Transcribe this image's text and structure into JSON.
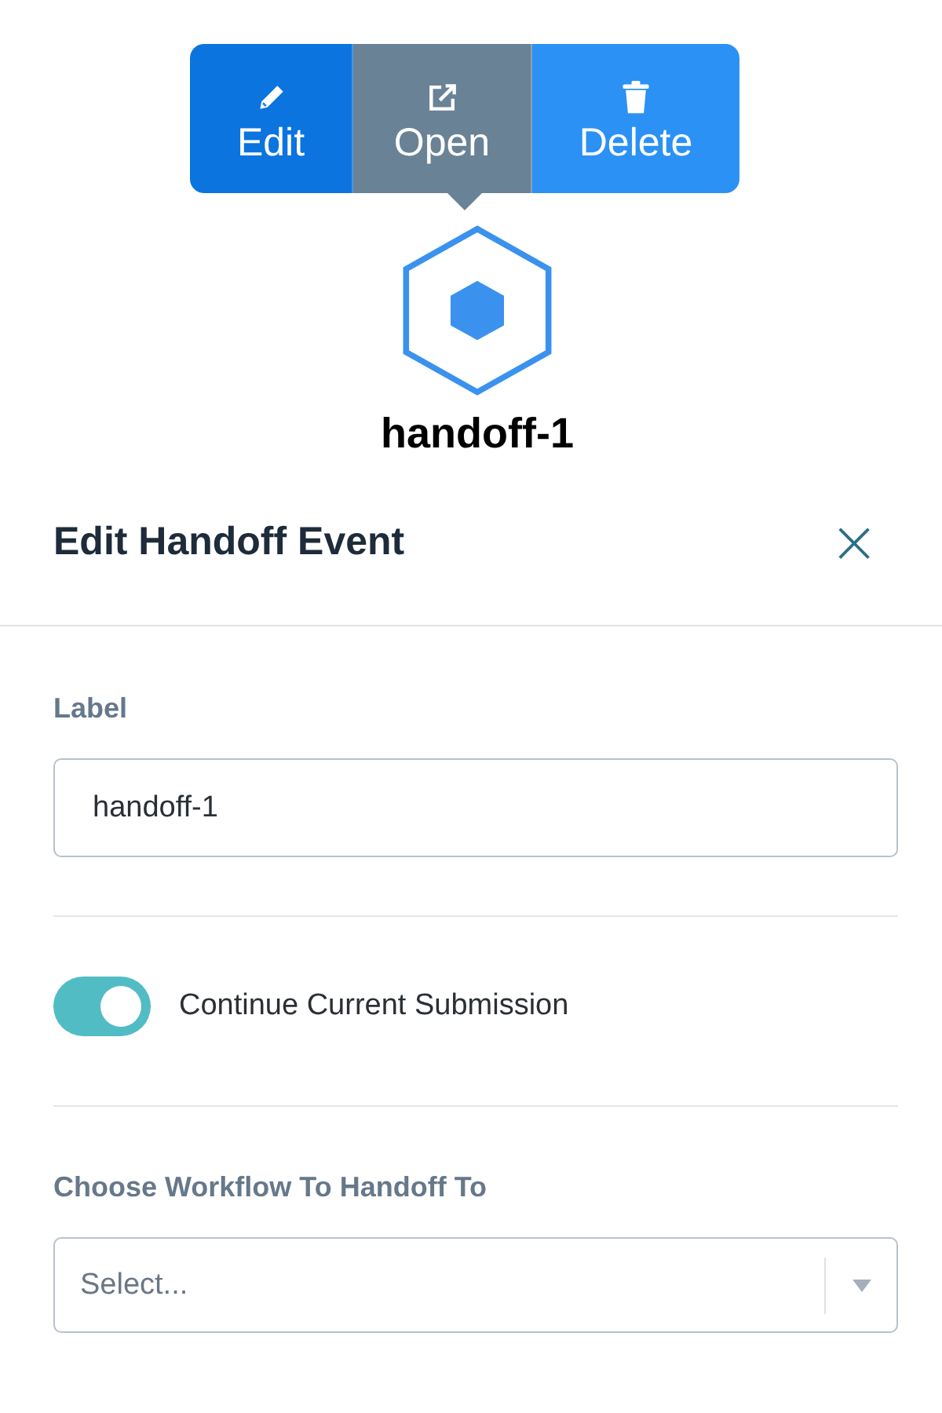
{
  "node_toolbar": {
    "buttons": [
      {
        "kind": "edit",
        "label": "Edit",
        "color": "#0b74de"
      },
      {
        "kind": "open",
        "label": "Open",
        "color": "#6a8296"
      },
      {
        "kind": "delete",
        "label": "Delete",
        "color": "#2b91f5"
      }
    ]
  },
  "node": {
    "label": "handoff-1"
  },
  "panel": {
    "title": "Edit Handoff Event",
    "close": "×",
    "label_field": {
      "label": "Label",
      "value": "handoff-1"
    },
    "toggle": {
      "label": "Continue Current Submission",
      "on": true
    },
    "workflow": {
      "label": "Choose Workflow To Handoff To",
      "placeholder": "Select..."
    }
  }
}
